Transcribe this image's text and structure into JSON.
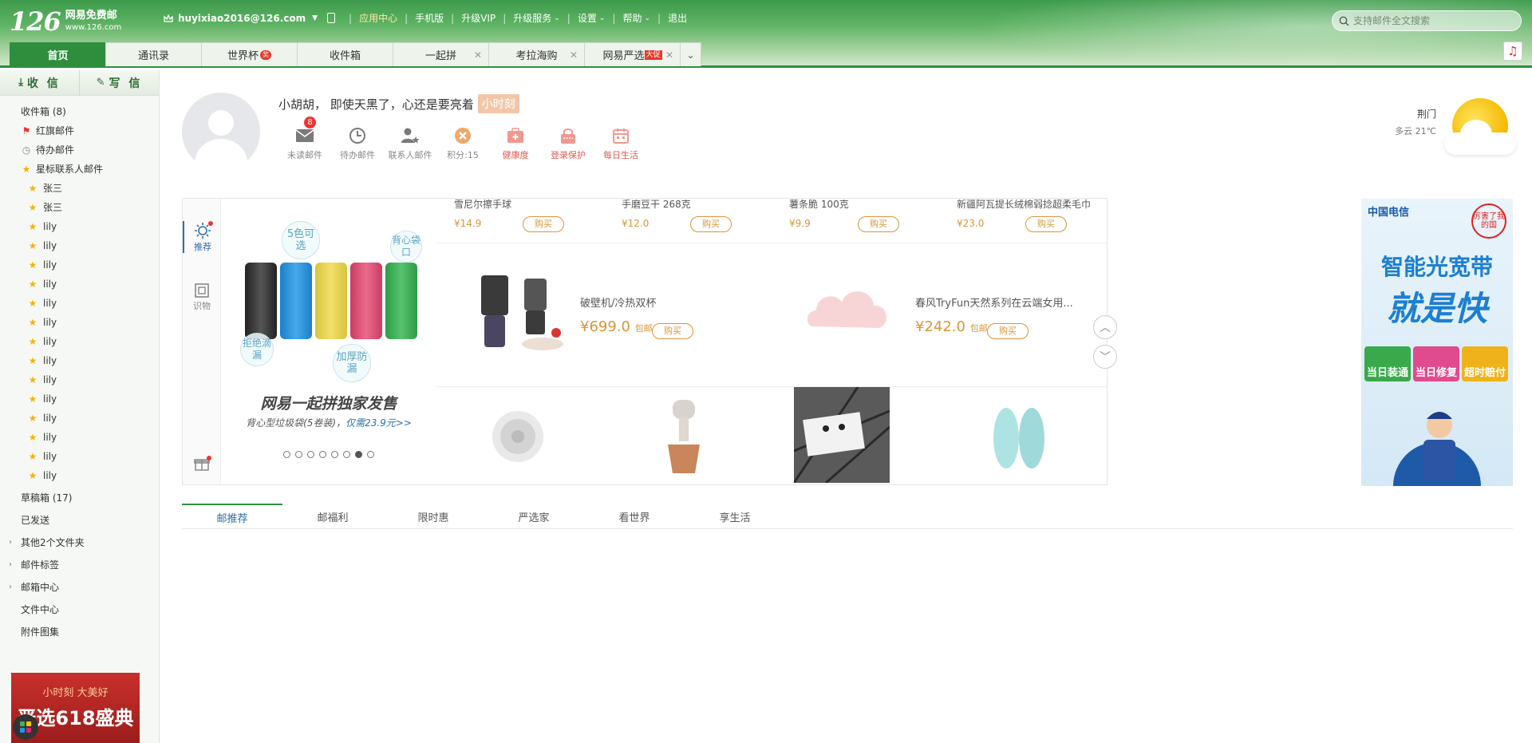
{
  "header": {
    "logo_number": "126",
    "logo_name": "网易免费邮",
    "logo_domain": "www.126.com",
    "account": "huyixiao2016@126.com",
    "nav": [
      "应用中心",
      "手机版",
      "升级VIP",
      "升级服务",
      "设置",
      "帮助",
      "退出"
    ],
    "search_placeholder": "支持邮件全文搜索"
  },
  "tabs": [
    {
      "label": "首页"
    },
    {
      "label": "通讯录"
    },
    {
      "label": "世界杯",
      "badge": "奖"
    },
    {
      "label": "收件箱"
    },
    {
      "label": "一起拼"
    },
    {
      "label": "考拉海购"
    },
    {
      "label": "网易严选",
      "badge": "大促"
    }
  ],
  "sidebar": {
    "receive": "收 信",
    "compose": "写 信",
    "inbox": "收件箱 (8)",
    "flagged": "红旗邮件",
    "todo": "待办邮件",
    "starred": "星标联系人邮件",
    "contacts": [
      "张三",
      "张三",
      "lily",
      "lily",
      "lily",
      "lily",
      "lily",
      "lily",
      "lily",
      "lily",
      "lily",
      "lily",
      "lily",
      "lily",
      "lily",
      "lily"
    ],
    "drafts": "草稿箱 (17)",
    "sent": "已发送",
    "other_folders": "其他2个文件夹",
    "mail_tags": "邮件标签",
    "mailbox_center": "邮箱中心",
    "file_center": "文件中心",
    "attachments": "附件图集",
    "ad_line1": "小时刻 大美好",
    "ad_line2": "严选618盛典"
  },
  "profile": {
    "greeting": "小胡胡， 即使天黑了，心还是要亮着",
    "tag": "小时刻",
    "quick": [
      {
        "label": "未读邮件",
        "count": "8"
      },
      {
        "label": "待办邮件"
      },
      {
        "label": "联系人邮件"
      },
      {
        "label": "积分:15"
      },
      {
        "label": "健康度"
      },
      {
        "label": "登录保护"
      },
      {
        "label": "每日生活"
      }
    ],
    "weather_city": "荆门",
    "weather_cond": "多云 21℃"
  },
  "promo": {
    "nav": [
      "推荐",
      "识物"
    ],
    "bubbles": [
      "5色可选",
      "背心袋口",
      "拒绝滴漏",
      "加厚防漏"
    ],
    "banner_title": "网易一起拼独家发售",
    "banner_sub": "背心型垃圾袋(5卷装)，",
    "banner_price": "仅需23.9元>>",
    "row1": [
      {
        "name": "雪尼尔擦手球",
        "price": "¥14.9"
      },
      {
        "name": "手磨豆干 268克",
        "price": "¥12.0"
      },
      {
        "name": "薯条脆 100克",
        "price": "¥9.9"
      },
      {
        "name": "新疆阿瓦提长绒棉弱捻超柔毛巾",
        "price": "¥23.0"
      }
    ],
    "row2": [
      {
        "name": "破壁机/冷热双杯",
        "price": "¥699.0",
        "ship": "包邮"
      },
      {
        "name": "春风TryFun天然系列在云端女用...",
        "price": "¥242.0",
        "ship": "包邮"
      }
    ],
    "buy": "购买"
  },
  "right_ad": {
    "brand": "中国电信",
    "stamp": "厉害了我的国",
    "line1": "智能光宽带",
    "line2": "就是快",
    "badges": [
      "当日装通",
      "当日修复",
      "超时赔付"
    ]
  },
  "bottom_tabs": [
    "邮推荐",
    "邮福利",
    "限时惠",
    "严选家",
    "看世界",
    "享生活"
  ]
}
